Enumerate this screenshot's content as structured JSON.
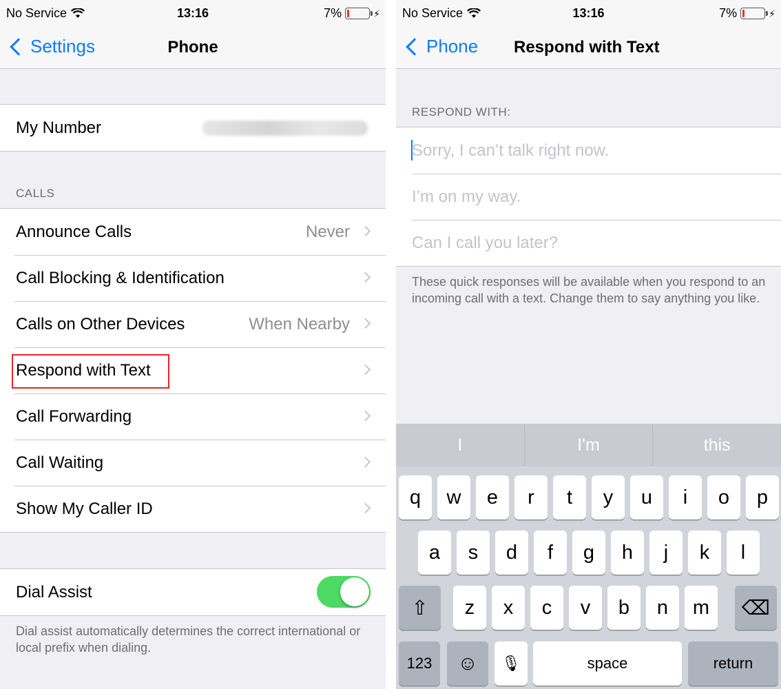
{
  "status": {
    "carrier": "No Service",
    "time": "13:16",
    "battery": "7%",
    "battery_level": 0.07
  },
  "left": {
    "nav": {
      "back_label": "Settings",
      "title": "Phone"
    },
    "my_number_label": "My Number",
    "calls_header": "CALLS",
    "rows": [
      {
        "label": "Announce Calls",
        "value": "Never"
      },
      {
        "label": "Call Blocking & Identification",
        "value": ""
      },
      {
        "label": "Calls on Other Devices",
        "value": "When Nearby"
      },
      {
        "label": "Respond with Text",
        "value": ""
      },
      {
        "label": "Call Forwarding",
        "value": ""
      },
      {
        "label": "Call Waiting",
        "value": ""
      },
      {
        "label": "Show My Caller ID",
        "value": ""
      }
    ],
    "dial_assist": {
      "label": "Dial Assist",
      "enabled": true,
      "description": "Dial assist automatically determines the correct international or local prefix when dialing."
    },
    "highlight_color": "#e8232a"
  },
  "right": {
    "nav": {
      "back_label": "Phone",
      "title": "Respond with Text"
    },
    "header": "RESPOND WITH:",
    "responses": [
      "Sorry, I can’t talk right now.",
      "I’m on my way.",
      "Can I call you later?"
    ],
    "footer": "These quick responses will be available when you respond to an incoming call with a text. Change them to say anything you like.",
    "keyboard": {
      "predictions": [
        "I",
        "I'm",
        "this"
      ],
      "rows": [
        [
          "q",
          "w",
          "e",
          "r",
          "t",
          "y",
          "u",
          "i",
          "o",
          "p"
        ],
        [
          "a",
          "s",
          "d",
          "f",
          "g",
          "h",
          "j",
          "k",
          "l"
        ],
        [
          "z",
          "x",
          "c",
          "v",
          "b",
          "n",
          "m"
        ]
      ],
      "numbers_label": "123",
      "space_label": "space",
      "return_label": "return",
      "shift_glyph": "⇧",
      "emoji_glyph": "☺",
      "mic_glyph": "🎙",
      "backspace_glyph": "⌫"
    }
  },
  "colors": {
    "ios_blue": "#0a7aff",
    "toggle_on": "#4cd964",
    "secondary_text": "#8e8e93",
    "group_background": "#efeff4"
  }
}
